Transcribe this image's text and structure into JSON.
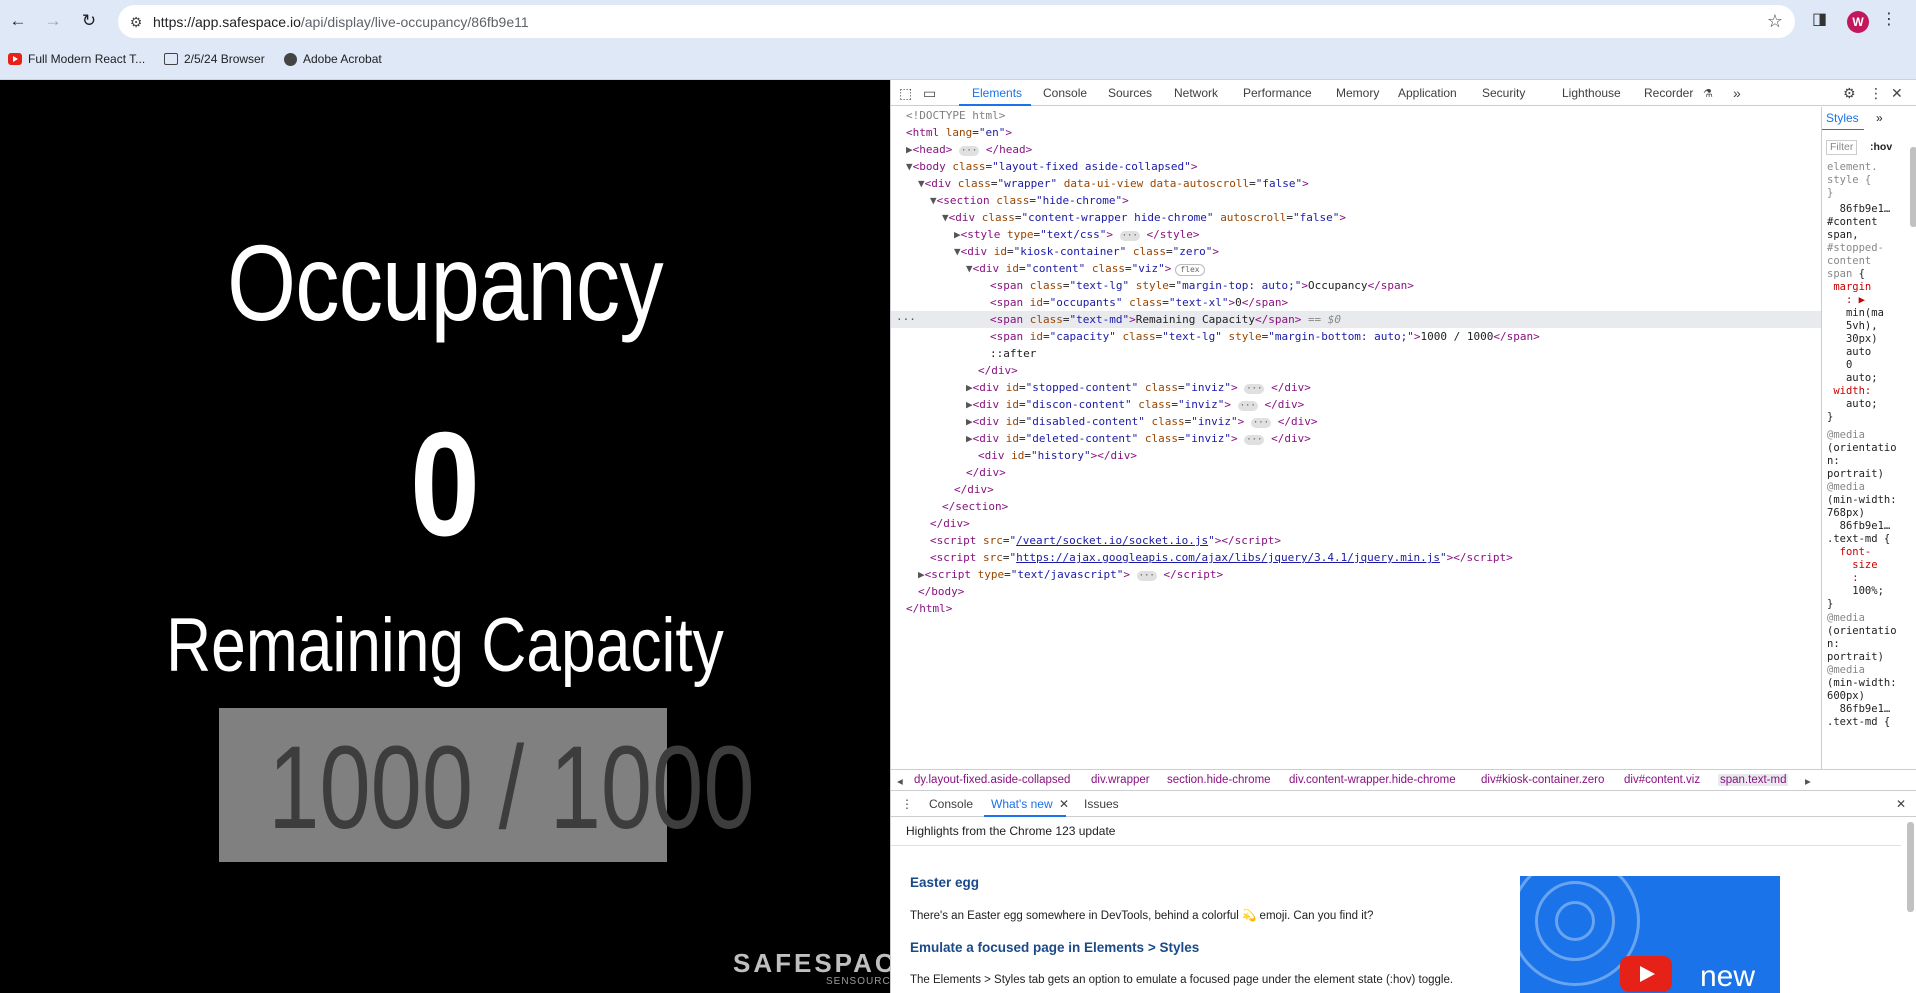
{
  "browser": {
    "url_host": "https://app.safespace.io",
    "url_path": "/api/display/live-occupancy/86fb9e11",
    "avatar_letter": "W",
    "bookmarks": [
      "Full Modern React T...",
      "2/5/24 Browser",
      "Adobe Acrobat"
    ]
  },
  "kiosk": {
    "title": "Occupancy",
    "occupants": "0",
    "remaining_label": "Remaining Capacity",
    "capacity": "1000 / 1000",
    "logo": "SAFESPACE",
    "logo_sub": "SENSOURCE"
  },
  "devtools": {
    "tabs": [
      "Elements",
      "Console",
      "Sources",
      "Network",
      "Performance",
      "Memory",
      "Application",
      "Security",
      "Lighthouse",
      "Recorder"
    ],
    "active_tab": "Elements",
    "styles_tab": "Styles",
    "filter_placeholder": "Filter",
    "hov": ":hov",
    "breadcrumbs": [
      "dy.layout-fixed.aside-collapsed",
      "div.wrapper",
      "section.hide-chrome",
      "div.content-wrapper.hide-chrome",
      "div#kiosk-container.zero",
      "div#content.viz",
      "span.text-md"
    ],
    "drawer_tabs": [
      "Console",
      "What's new",
      "Issues"
    ],
    "whats_new": {
      "header": "Highlights from the Chrome 123 update",
      "item1_title": "Easter egg",
      "item1_text": "There's an Easter egg somewhere in DevTools, behind a colorful 💫 emoji. Can you find it?",
      "item2_title": "Emulate a focused page in Elements > Styles",
      "item2_text": "The Elements > Styles tab gets an option to emulate a focused page under the element state (:hov) toggle.",
      "thumb_text": "new"
    }
  }
}
